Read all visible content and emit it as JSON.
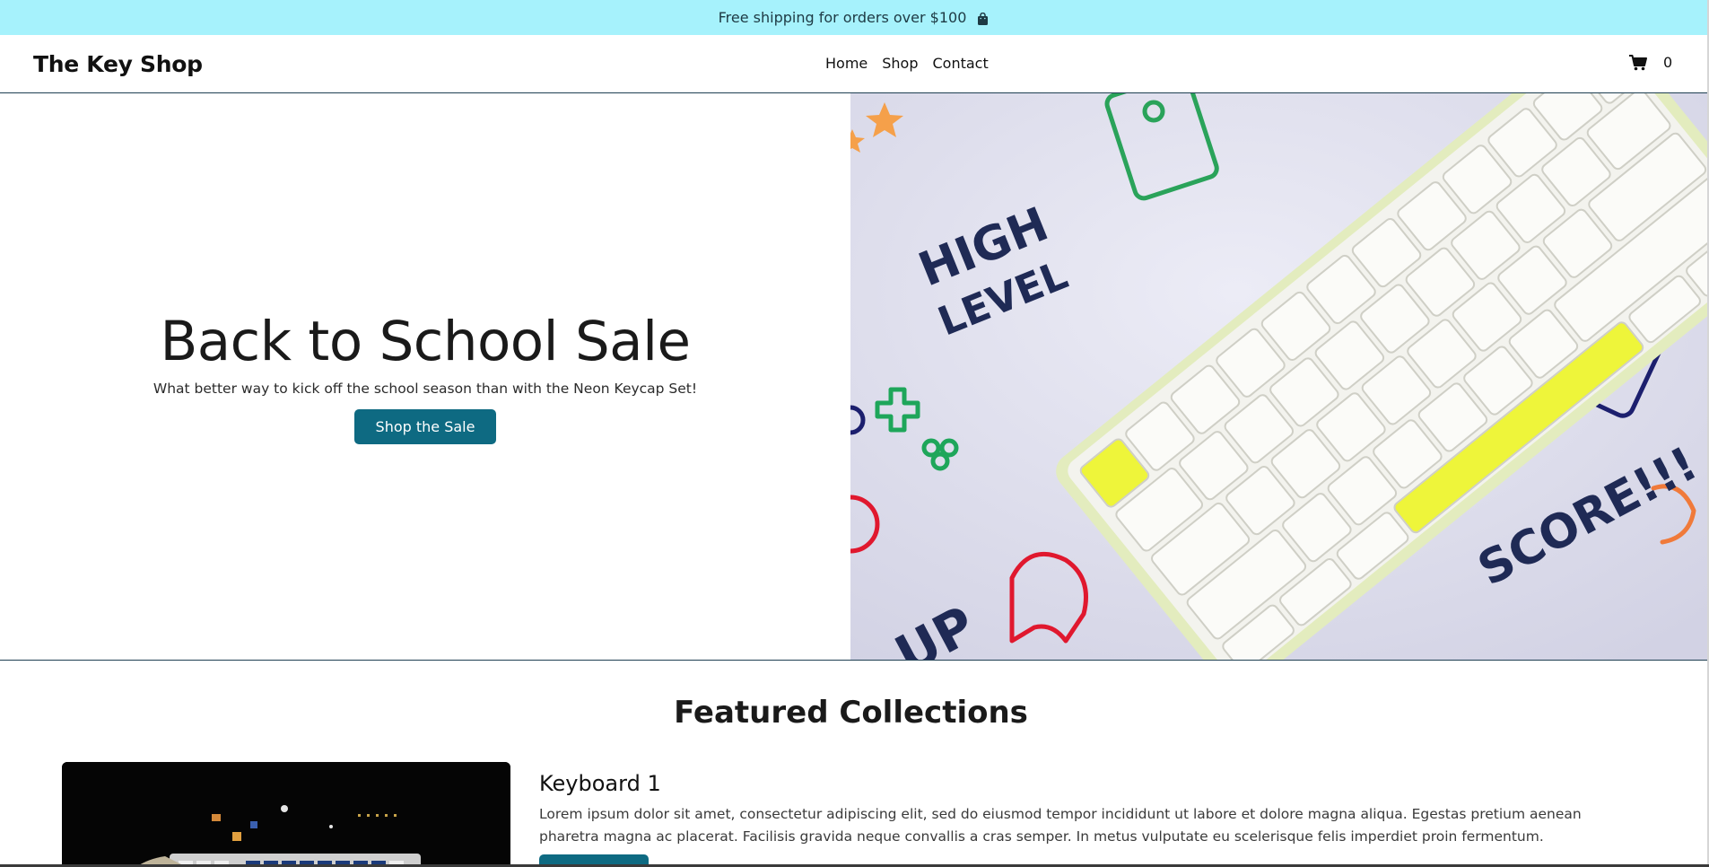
{
  "announcement": {
    "text": "Free shipping for orders over $100",
    "icon": "shopping-bag-icon"
  },
  "navbar": {
    "brand": "The Key Shop",
    "links": [
      "Home",
      "Shop",
      "Contact"
    ],
    "cart_icon": "cart-icon",
    "cart_count": "0"
  },
  "hero": {
    "title": "Back to School Sale",
    "subtitle": "What better way to kick off the school season than with the Neon Keycap Set!",
    "button": "Shop the Sale",
    "image_text": [
      "HIGH",
      "LEVEL",
      "SCORE!!!",
      "UP"
    ]
  },
  "featured": {
    "title": "Featured Collections",
    "items": [
      {
        "title": "Keyboard 1",
        "text": "Lorem ipsum dolor sit amet, consectetur adipiscing elit, sed do eiusmod tempor incididunt ut labore et dolore magna aliqua. Egestas pretium aenean pharetra magna ac placerat. Facilisis gravida neque convallis a cras semper. In metus vulputate eu scelerisque felis imperdiet proin fermentum."
      }
    ]
  },
  "colors": {
    "announcement_bg": "#a6f2fc",
    "accent": "#0e6a82",
    "neon_yellow": "#eef53a"
  }
}
